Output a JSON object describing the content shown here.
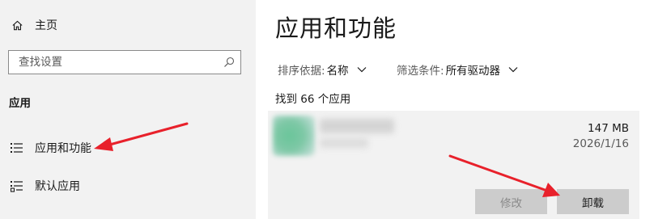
{
  "sidebar": {
    "home_label": "主页",
    "search_placeholder": "查找设置",
    "section_heading": "应用",
    "items": [
      {
        "label": "应用和功能",
        "icon": "list-icon"
      },
      {
        "label": "默认应用",
        "icon": "default-apps-icon"
      }
    ]
  },
  "main": {
    "title": "应用和功能",
    "sort": {
      "label": "排序依据:",
      "value": "名称"
    },
    "filter": {
      "label": "筛选条件:",
      "value": "所有驱动器"
    },
    "found_text": "找到 66 个应用",
    "app": {
      "size": "147 MB",
      "date": "2026/1/16",
      "modify_label": "修改",
      "uninstall_label": "卸载"
    }
  },
  "colors": {
    "annotation_arrow": "#e8212b",
    "sidebar_bg": "#f2f2f2",
    "button_bg": "#cccccc"
  }
}
